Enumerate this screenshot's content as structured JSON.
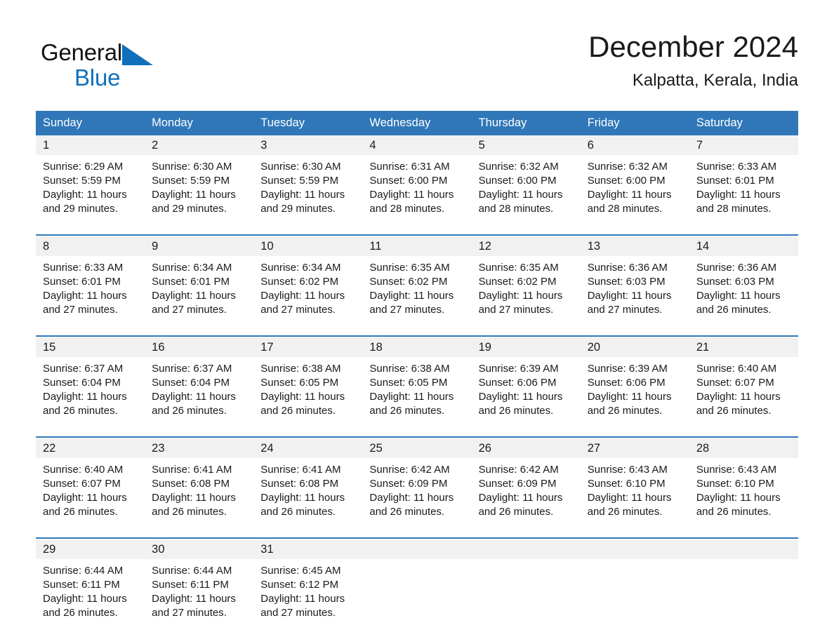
{
  "brand": {
    "name_part1": "General",
    "name_part2": "Blue",
    "triangle_color": "#1070bb",
    "accent_color": "#1070bb"
  },
  "header": {
    "title": "December 2024",
    "subtitle": "Kalpatta, Kerala, India"
  },
  "theme": {
    "header_row_bg": "#2f77b8",
    "week_rule_color": "#2f77b8",
    "daynum_bg": "#f1f1f1",
    "text_color": "#1a1a1a"
  },
  "weekday_headers": [
    "Sunday",
    "Monday",
    "Tuesday",
    "Wednesday",
    "Thursday",
    "Friday",
    "Saturday"
  ],
  "weeks": [
    [
      {
        "day": "1",
        "sunrise": "Sunrise: 6:29 AM",
        "sunset": "Sunset: 5:59 PM",
        "daylight_line1": "Daylight: 11 hours",
        "daylight_line2": "and 29 minutes."
      },
      {
        "day": "2",
        "sunrise": "Sunrise: 6:30 AM",
        "sunset": "Sunset: 5:59 PM",
        "daylight_line1": "Daylight: 11 hours",
        "daylight_line2": "and 29 minutes."
      },
      {
        "day": "3",
        "sunrise": "Sunrise: 6:30 AM",
        "sunset": "Sunset: 5:59 PM",
        "daylight_line1": "Daylight: 11 hours",
        "daylight_line2": "and 29 minutes."
      },
      {
        "day": "4",
        "sunrise": "Sunrise: 6:31 AM",
        "sunset": "Sunset: 6:00 PM",
        "daylight_line1": "Daylight: 11 hours",
        "daylight_line2": "and 28 minutes."
      },
      {
        "day": "5",
        "sunrise": "Sunrise: 6:32 AM",
        "sunset": "Sunset: 6:00 PM",
        "daylight_line1": "Daylight: 11 hours",
        "daylight_line2": "and 28 minutes."
      },
      {
        "day": "6",
        "sunrise": "Sunrise: 6:32 AM",
        "sunset": "Sunset: 6:00 PM",
        "daylight_line1": "Daylight: 11 hours",
        "daylight_line2": "and 28 minutes."
      },
      {
        "day": "7",
        "sunrise": "Sunrise: 6:33 AM",
        "sunset": "Sunset: 6:01 PM",
        "daylight_line1": "Daylight: 11 hours",
        "daylight_line2": "and 28 minutes."
      }
    ],
    [
      {
        "day": "8",
        "sunrise": "Sunrise: 6:33 AM",
        "sunset": "Sunset: 6:01 PM",
        "daylight_line1": "Daylight: 11 hours",
        "daylight_line2": "and 27 minutes."
      },
      {
        "day": "9",
        "sunrise": "Sunrise: 6:34 AM",
        "sunset": "Sunset: 6:01 PM",
        "daylight_line1": "Daylight: 11 hours",
        "daylight_line2": "and 27 minutes."
      },
      {
        "day": "10",
        "sunrise": "Sunrise: 6:34 AM",
        "sunset": "Sunset: 6:02 PM",
        "daylight_line1": "Daylight: 11 hours",
        "daylight_line2": "and 27 minutes."
      },
      {
        "day": "11",
        "sunrise": "Sunrise: 6:35 AM",
        "sunset": "Sunset: 6:02 PM",
        "daylight_line1": "Daylight: 11 hours",
        "daylight_line2": "and 27 minutes."
      },
      {
        "day": "12",
        "sunrise": "Sunrise: 6:35 AM",
        "sunset": "Sunset: 6:02 PM",
        "daylight_line1": "Daylight: 11 hours",
        "daylight_line2": "and 27 minutes."
      },
      {
        "day": "13",
        "sunrise": "Sunrise: 6:36 AM",
        "sunset": "Sunset: 6:03 PM",
        "daylight_line1": "Daylight: 11 hours",
        "daylight_line2": "and 27 minutes."
      },
      {
        "day": "14",
        "sunrise": "Sunrise: 6:36 AM",
        "sunset": "Sunset: 6:03 PM",
        "daylight_line1": "Daylight: 11 hours",
        "daylight_line2": "and 26 minutes."
      }
    ],
    [
      {
        "day": "15",
        "sunrise": "Sunrise: 6:37 AM",
        "sunset": "Sunset: 6:04 PM",
        "daylight_line1": "Daylight: 11 hours",
        "daylight_line2": "and 26 minutes."
      },
      {
        "day": "16",
        "sunrise": "Sunrise: 6:37 AM",
        "sunset": "Sunset: 6:04 PM",
        "daylight_line1": "Daylight: 11 hours",
        "daylight_line2": "and 26 minutes."
      },
      {
        "day": "17",
        "sunrise": "Sunrise: 6:38 AM",
        "sunset": "Sunset: 6:05 PM",
        "daylight_line1": "Daylight: 11 hours",
        "daylight_line2": "and 26 minutes."
      },
      {
        "day": "18",
        "sunrise": "Sunrise: 6:38 AM",
        "sunset": "Sunset: 6:05 PM",
        "daylight_line1": "Daylight: 11 hours",
        "daylight_line2": "and 26 minutes."
      },
      {
        "day": "19",
        "sunrise": "Sunrise: 6:39 AM",
        "sunset": "Sunset: 6:06 PM",
        "daylight_line1": "Daylight: 11 hours",
        "daylight_line2": "and 26 minutes."
      },
      {
        "day": "20",
        "sunrise": "Sunrise: 6:39 AM",
        "sunset": "Sunset: 6:06 PM",
        "daylight_line1": "Daylight: 11 hours",
        "daylight_line2": "and 26 minutes."
      },
      {
        "day": "21",
        "sunrise": "Sunrise: 6:40 AM",
        "sunset": "Sunset: 6:07 PM",
        "daylight_line1": "Daylight: 11 hours",
        "daylight_line2": "and 26 minutes."
      }
    ],
    [
      {
        "day": "22",
        "sunrise": "Sunrise: 6:40 AM",
        "sunset": "Sunset: 6:07 PM",
        "daylight_line1": "Daylight: 11 hours",
        "daylight_line2": "and 26 minutes."
      },
      {
        "day": "23",
        "sunrise": "Sunrise: 6:41 AM",
        "sunset": "Sunset: 6:08 PM",
        "daylight_line1": "Daylight: 11 hours",
        "daylight_line2": "and 26 minutes."
      },
      {
        "day": "24",
        "sunrise": "Sunrise: 6:41 AM",
        "sunset": "Sunset: 6:08 PM",
        "daylight_line1": "Daylight: 11 hours",
        "daylight_line2": "and 26 minutes."
      },
      {
        "day": "25",
        "sunrise": "Sunrise: 6:42 AM",
        "sunset": "Sunset: 6:09 PM",
        "daylight_line1": "Daylight: 11 hours",
        "daylight_line2": "and 26 minutes."
      },
      {
        "day": "26",
        "sunrise": "Sunrise: 6:42 AM",
        "sunset": "Sunset: 6:09 PM",
        "daylight_line1": "Daylight: 11 hours",
        "daylight_line2": "and 26 minutes."
      },
      {
        "day": "27",
        "sunrise": "Sunrise: 6:43 AM",
        "sunset": "Sunset: 6:10 PM",
        "daylight_line1": "Daylight: 11 hours",
        "daylight_line2": "and 26 minutes."
      },
      {
        "day": "28",
        "sunrise": "Sunrise: 6:43 AM",
        "sunset": "Sunset: 6:10 PM",
        "daylight_line1": "Daylight: 11 hours",
        "daylight_line2": "and 26 minutes."
      }
    ],
    [
      {
        "day": "29",
        "sunrise": "Sunrise: 6:44 AM",
        "sunset": "Sunset: 6:11 PM",
        "daylight_line1": "Daylight: 11 hours",
        "daylight_line2": "and 26 minutes."
      },
      {
        "day": "30",
        "sunrise": "Sunrise: 6:44 AM",
        "sunset": "Sunset: 6:11 PM",
        "daylight_line1": "Daylight: 11 hours",
        "daylight_line2": "and 27 minutes."
      },
      {
        "day": "31",
        "sunrise": "Sunrise: 6:45 AM",
        "sunset": "Sunset: 6:12 PM",
        "daylight_line1": "Daylight: 11 hours",
        "daylight_line2": "and 27 minutes."
      },
      {
        "day": "",
        "sunrise": "",
        "sunset": "",
        "daylight_line1": "",
        "daylight_line2": ""
      },
      {
        "day": "",
        "sunrise": "",
        "sunset": "",
        "daylight_line1": "",
        "daylight_line2": ""
      },
      {
        "day": "",
        "sunrise": "",
        "sunset": "",
        "daylight_line1": "",
        "daylight_line2": ""
      },
      {
        "day": "",
        "sunrise": "",
        "sunset": "",
        "daylight_line1": "",
        "daylight_line2": ""
      }
    ]
  ]
}
